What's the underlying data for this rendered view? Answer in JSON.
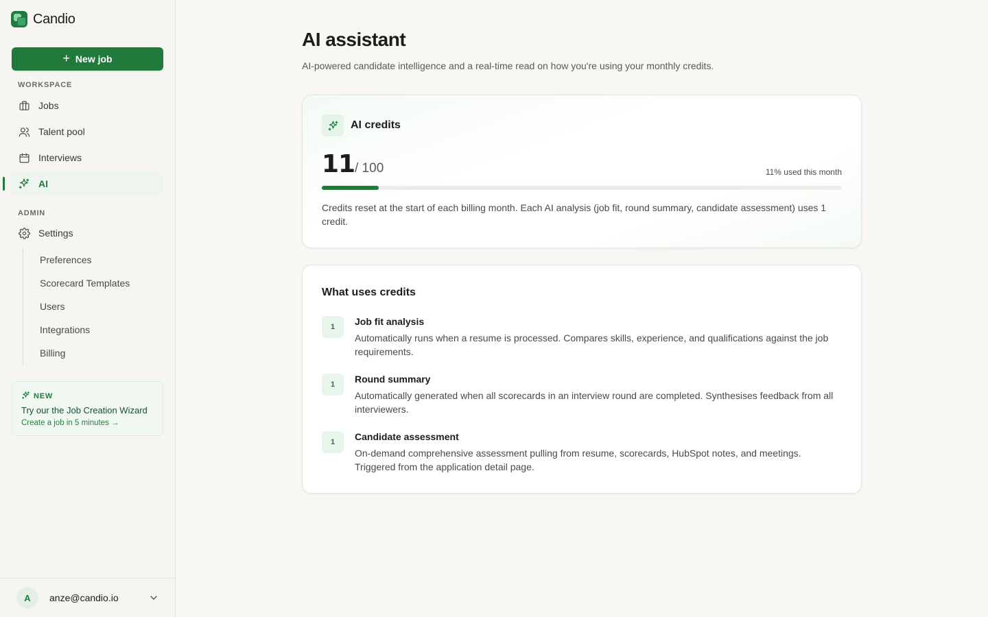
{
  "brand": {
    "name": "Candio"
  },
  "sidebar": {
    "new_job_label": "New job",
    "workspace_label": "WORKSPACE",
    "workspace_items": [
      {
        "label": "Jobs",
        "icon": "briefcase-icon"
      },
      {
        "label": "Talent pool",
        "icon": "users-icon"
      },
      {
        "label": "Interviews",
        "icon": "calendar-icon"
      },
      {
        "label": "AI",
        "icon": "sparkles-icon",
        "active": true
      }
    ],
    "admin_label": "ADMIN",
    "settings_label": "Settings",
    "settings_items": [
      "Preferences",
      "Scorecard Templates",
      "Users",
      "Integrations",
      "Billing"
    ],
    "promo": {
      "badge": "NEW",
      "title": "Try our the Job Creation Wizard",
      "link": "Create a job in 5 minutes →"
    },
    "user": {
      "initial": "A",
      "email": "anze@candio.io"
    }
  },
  "main": {
    "title": "AI assistant",
    "subtitle": "AI-powered candidate intelligence and a real-time read on how you're using your monthly credits.",
    "credits": {
      "title": "AI credits",
      "used": "11",
      "total": "/ 100",
      "used_fraction": 0.11,
      "pct_label": "11% used this month",
      "note": "Credits reset at the start of each billing month. Each AI analysis (job fit, round summary, candidate assessment) uses 1 credit."
    },
    "uses": {
      "title": "What uses credits",
      "items": [
        {
          "cost": "1",
          "name": "Job fit analysis",
          "desc": "Automatically runs when a resume is processed. Compares skills, experience, and qualifications against the job requirements."
        },
        {
          "cost": "1",
          "name": "Round summary",
          "desc": "Automatically generated when all scorecards in an interview round are completed. Synthesises feedback from all interviewers."
        },
        {
          "cost": "1",
          "name": "Candidate assessment",
          "desc": "On-demand comprehensive assessment pulling from resume, scorecards, HubSpot notes, and meetings. Triggered from the application detail page."
        }
      ]
    }
  },
  "colors": {
    "accent": "#1f7a3c",
    "accent_light": "#e8f5ea"
  }
}
